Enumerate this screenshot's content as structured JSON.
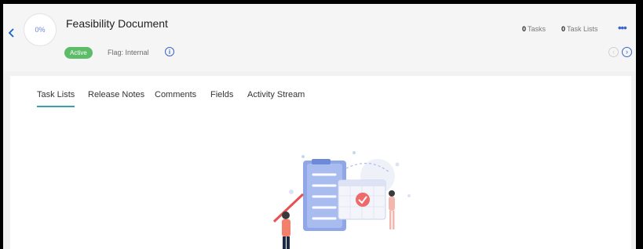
{
  "header": {
    "progress": "0%",
    "title": "Feasibility Document",
    "status": "Active",
    "flag": "Flag: Internal",
    "tasks_count": "0",
    "tasks_label": "Tasks",
    "task_lists_count": "0",
    "task_lists_label": "Task Lists",
    "more": "•••",
    "back_icon": "chevron-left-icon",
    "info_icon": "info-icon",
    "prev_icon": "circle-chevron-left-icon",
    "next_icon": "circle-chevron-right-icon"
  },
  "tabs": [
    {
      "label": "Task Lists",
      "active": true
    },
    {
      "label": "Release Notes",
      "active": false
    },
    {
      "label": "Comments",
      "active": false
    },
    {
      "label": "Fields",
      "active": false
    },
    {
      "label": "Activity Stream",
      "active": false
    }
  ],
  "colors": {
    "accent": "#3b63c9",
    "status_green": "#5cbc68",
    "active_tab_underline": "#3a9eae"
  }
}
